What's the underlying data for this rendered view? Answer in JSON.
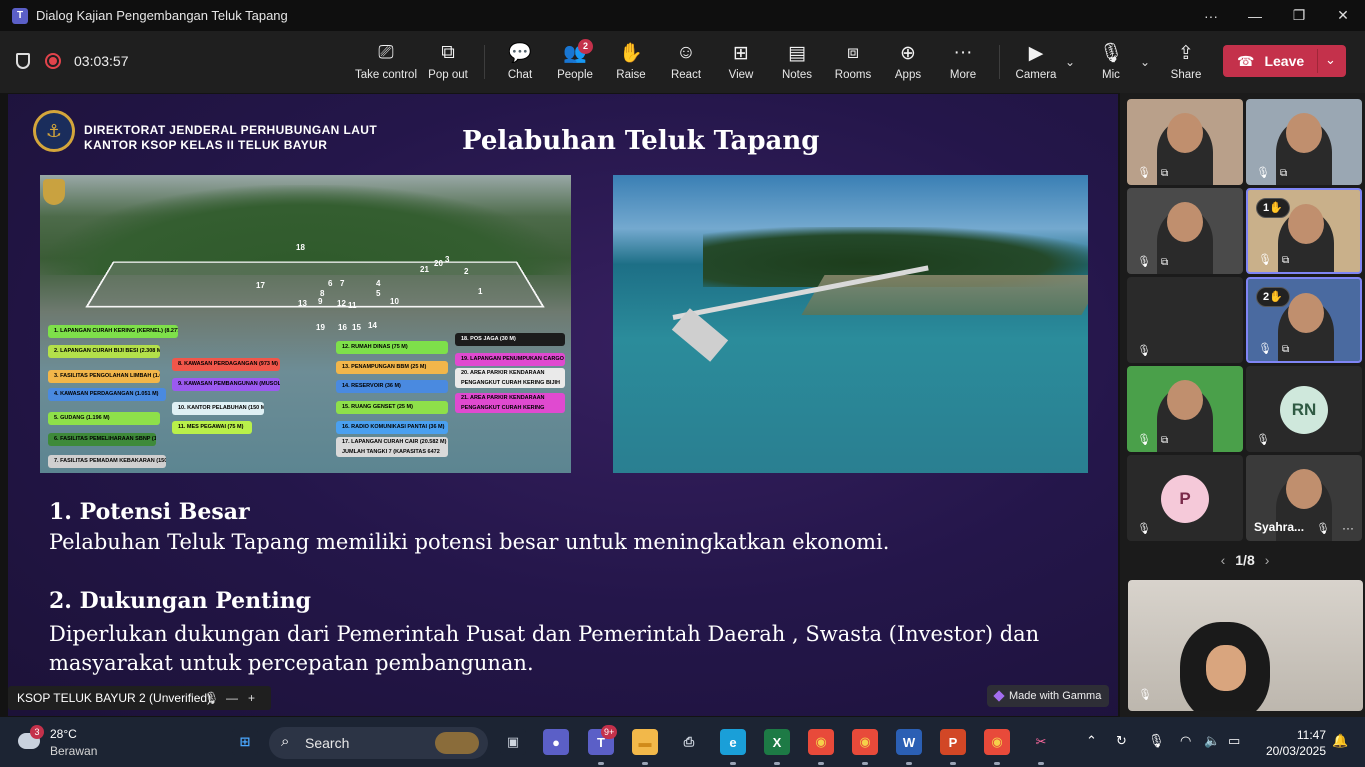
{
  "window": {
    "title": "Dialog Kajian Pengembangan Teluk Tapang",
    "app_icon": "T"
  },
  "meeting": {
    "timer": "03:03:57",
    "toolbar": [
      {
        "id": "take-control",
        "label": "Take control",
        "icon": "⎚"
      },
      {
        "id": "pop-out",
        "label": "Pop out",
        "icon": "⧉"
      },
      {
        "id": "chat",
        "label": "Chat",
        "icon": "💬"
      },
      {
        "id": "people",
        "label": "People",
        "icon": "👥",
        "badge": "2"
      },
      {
        "id": "raise",
        "label": "Raise",
        "icon": "✋"
      },
      {
        "id": "react",
        "label": "React",
        "icon": "☺"
      },
      {
        "id": "view",
        "label": "View",
        "icon": "⊞"
      },
      {
        "id": "notes",
        "label": "Notes",
        "icon": "▤"
      },
      {
        "id": "rooms",
        "label": "Rooms",
        "icon": "⧈"
      },
      {
        "id": "apps",
        "label": "Apps",
        "icon": "⊕"
      },
      {
        "id": "more",
        "label": "More",
        "icon": "···"
      },
      {
        "id": "camera",
        "label": "Camera",
        "icon": "▶"
      },
      {
        "id": "mic",
        "label": "Mic",
        "icon": "🎙"
      },
      {
        "id": "share",
        "label": "Share",
        "icon": "⇪"
      }
    ],
    "leave_label": "Leave"
  },
  "slide": {
    "org_line1": "DIREKTORAT JENDERAL PERHUBUNGAN LAUT",
    "org_line2": "KANTOR KSOP KELAS II TELUK BAYUR",
    "title": "Pelabuhan Teluk Tapang",
    "legend": [
      {
        "text": "1. LAPANGAN CURAH KERING (KERNEL) (8.277 M)",
        "color": "#7ee04a"
      },
      {
        "text": "2. LAPANGAN CURAH BIJI BESI (2.308 M)",
        "color": "#b3e04a"
      },
      {
        "text": "3. FASILITAS PENGOLAHAN LIMBAH (1.015 M)",
        "color": "#f2b64a"
      },
      {
        "text": "4. KAWASAN PERDAGANGAN (1.051 M)",
        "color": "#4a8ae0"
      },
      {
        "text": "5. GUDANG (1.196 M)",
        "color": "#8ee04a"
      },
      {
        "text": "6. FASILITAS PEMELIHARAAN SBNP (150 M)",
        "color": "#3e8a3a"
      },
      {
        "text": "7. FASILITAS PEMADAM KEBAKARAN (150 M)",
        "color": "#cfcfcf"
      },
      {
        "text": "8. KAWASAN PERDAGANGAN (973 M)",
        "color": "#f0564a"
      },
      {
        "text": "9. KAWASAN PEMBANGUNAN (MUSOLA) (168 M)",
        "color": "#9b5af0"
      },
      {
        "text": "10. KANTOR PELABUHAN (150 M)",
        "color": "#dff0f4"
      },
      {
        "text": "11. MES PEGAWAI (75 M)",
        "color": "#b9f04a"
      },
      {
        "text": "12. RUMAH DINAS (75 M)",
        "color": "#7ee04a"
      },
      {
        "text": "13. PENAMPUNGAN BBM (25 M)",
        "color": "#f2b64a"
      },
      {
        "text": "14. RESERVOIR (36 M)",
        "color": "#4a8ae0"
      },
      {
        "text": "15. RUANG GENSET (25 M)",
        "color": "#8ee04a"
      },
      {
        "text": "16. RADIO KOMUNIKASI PANTAI (36 M)",
        "color": "#4aa0f0"
      },
      {
        "text": "17. LAPANGAN CURAH CAIR (20.582 M) JUMLAH TANGKI 7 (KAPASITAS 6472 TON)",
        "color": "#d9d9d9"
      },
      {
        "text": "18. POS JAGA (30 M)",
        "color": "#1c1c1c"
      },
      {
        "text": "19. LAPANGAN PENUMPUKAN CARGO (1.345 M)",
        "color": "#e04ad0"
      },
      {
        "text": "20. AREA PARKIR KENDARAAN PENGANGKUT CURAH KERING BIJIH BESI (280 M)",
        "color": "#eaeaea"
      },
      {
        "text": "21. AREA PARKIR KENDARAAN PENGANGKUT CURAH KERING (KERNEL) (2.726 M)",
        "color": "#e04ad0"
      }
    ],
    "map_numbers": [
      "18",
      "17",
      "21",
      "20",
      "3",
      "2",
      "1",
      "6",
      "7",
      "4",
      "8",
      "5",
      "9",
      "12",
      "11",
      "10",
      "19",
      "16",
      "15",
      "14",
      "13"
    ],
    "point1_heading": "1. Potensi Besar",
    "point1_text": "Pelabuhan Teluk Tapang memiliki potensi besar untuk meningkatkan ekonomi.",
    "point2_heading": "2. Dukungan Penting",
    "point2_text": "Diperlukan dukungan dari Pemerintah Pusat dan Pemerintah Daerah , Swasta (Investor) dan masyarakat untuk percepatan pembangunan.",
    "badge": "Made with Gamma"
  },
  "presenter_name": "KSOP TELUK BAYUR 2 (Unverified)",
  "gallery": {
    "tiles": [
      {
        "id": "p1",
        "kind": "video",
        "color": "#b9a08a"
      },
      {
        "id": "p2",
        "kind": "video",
        "color": "#9aa7b3"
      },
      {
        "id": "p3",
        "kind": "video",
        "color": "#4a4a4a"
      },
      {
        "id": "p4",
        "kind": "video",
        "color": "#c9b08a",
        "hand": "1✋"
      },
      {
        "id": "p5",
        "kind": "blank",
        "color": "#2a2a2a"
      },
      {
        "id": "p6",
        "kind": "video",
        "color": "#4a6aa0",
        "hand": "2✋"
      },
      {
        "id": "p7",
        "kind": "video",
        "color": "#4aa04a"
      },
      {
        "id": "p8",
        "kind": "initials",
        "initials": "RN",
        "avatar_color": "#cfe8dc",
        "text_color": "#2f5a43"
      },
      {
        "id": "p9",
        "kind": "initials",
        "initials": "P",
        "avatar_color": "#f5c9d9",
        "text_color": "#7a2a4a"
      },
      {
        "id": "p10",
        "kind": "named",
        "name": "Syahra...",
        "color": "#3a3a3a"
      }
    ],
    "page": "1/8"
  },
  "taskbar": {
    "weather_temp": "28°C",
    "weather_cond": "Berawan",
    "weather_badge": "3",
    "search_label": "Search",
    "teams_badge": "9+",
    "apps": [
      {
        "id": "start",
        "glyph": "⊞",
        "bg": "#1c2433",
        "fg": "#4aa8ff"
      },
      {
        "id": "task-view",
        "glyph": "▣",
        "bg": "#1c2433",
        "fg": "#cfd6e0"
      },
      {
        "id": "meet",
        "glyph": "●",
        "bg": "#5b5fc7",
        "fg": "#fff"
      },
      {
        "id": "teams",
        "glyph": "T",
        "bg": "#5b5fc7",
        "fg": "#fff"
      },
      {
        "id": "explorer",
        "glyph": "▬",
        "bg": "#f2b84a",
        "fg": "#d08a1a"
      },
      {
        "id": "printer",
        "glyph": "⎙",
        "bg": "#1c2433",
        "fg": "#cfd6e0"
      },
      {
        "id": "edge",
        "glyph": "e",
        "bg": "#1a9fd8",
        "fg": "#fff"
      },
      {
        "id": "excel",
        "glyph": "X",
        "bg": "#1d7a45",
        "fg": "#fff"
      },
      {
        "id": "chrome",
        "glyph": "◉",
        "bg": "#e84a3a",
        "fg": "#f5d04a"
      },
      {
        "id": "chrome-2",
        "glyph": "◉",
        "bg": "#e84a3a",
        "fg": "#f5d04a"
      },
      {
        "id": "word",
        "glyph": "W",
        "bg": "#2b5fb4",
        "fg": "#fff"
      },
      {
        "id": "powerpoint",
        "glyph": "P",
        "bg": "#d24726",
        "fg": "#fff"
      },
      {
        "id": "chrome-3",
        "glyph": "◉",
        "bg": "#e84a3a",
        "fg": "#f5d04a"
      },
      {
        "id": "snip",
        "glyph": "✂",
        "bg": "#1c2433",
        "fg": "#ff6aa0"
      }
    ],
    "time": "11:47",
    "date": "20/03/2025"
  }
}
